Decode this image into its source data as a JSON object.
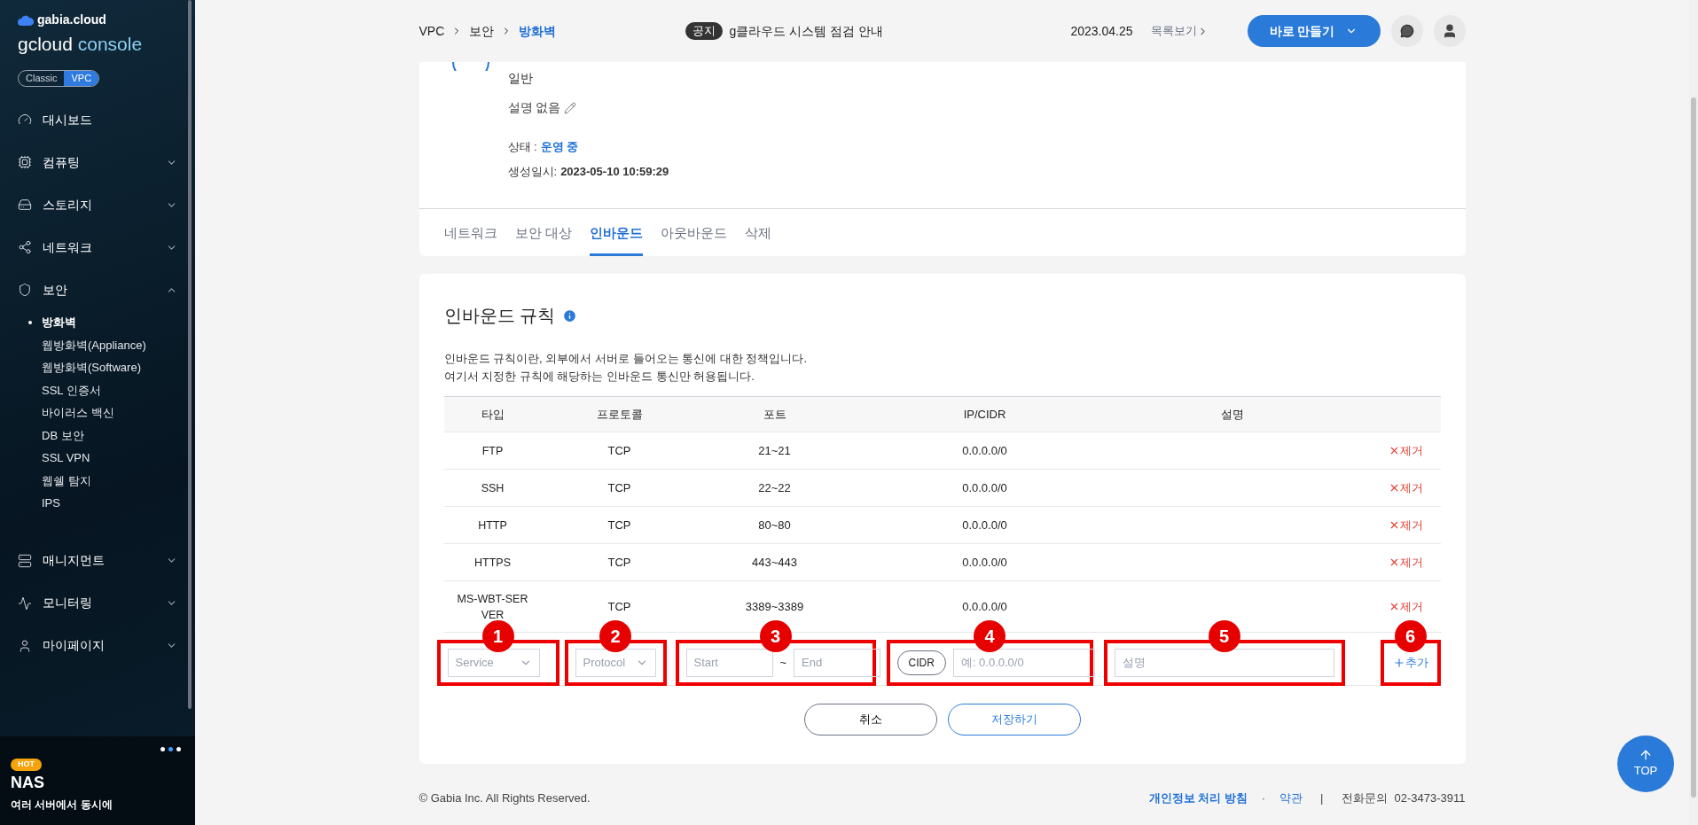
{
  "sidebar": {
    "brand": "gabia.cloud",
    "product_name": "gcloud",
    "product_suffix": "console",
    "mode_toggle": [
      {
        "label": "Classic",
        "selected": false
      },
      {
        "label": "VPC",
        "selected": true
      }
    ],
    "menu": [
      {
        "label": "대시보드",
        "kind": "link"
      },
      {
        "label": "컴퓨팅",
        "kind": "group",
        "expanded": false
      },
      {
        "label": "스토리지",
        "kind": "group",
        "expanded": false
      },
      {
        "label": "네트워크",
        "kind": "group",
        "expanded": false
      },
      {
        "label": "보안",
        "kind": "group",
        "expanded": true,
        "children": [
          {
            "label": "방화벽",
            "selected": true
          },
          {
            "label": "웹방화벽(Appliance)",
            "selected": false
          },
          {
            "label": "웹방화벽(Software)",
            "selected": false
          },
          {
            "label": "SSL 인증서",
            "selected": false
          },
          {
            "label": "바이러스 백신",
            "selected": false
          },
          {
            "label": "DB 보안",
            "selected": false
          },
          {
            "label": "SSL VPN",
            "selected": false
          },
          {
            "label": "웹쉘 탐지",
            "selected": false
          },
          {
            "label": "IPS",
            "selected": false
          }
        ]
      },
      {
        "label": "매니지먼트",
        "kind": "group",
        "expanded": false
      },
      {
        "label": "모니터링",
        "kind": "group",
        "expanded": false
      },
      {
        "label": "마이페이지",
        "kind": "group",
        "expanded": false
      }
    ],
    "banner": {
      "badge": "HOT",
      "title": "NAS",
      "text": "여러 서버에서 동시에",
      "dots": [
        {
          "selected": false
        },
        {
          "selected": true
        },
        {
          "selected": false
        }
      ]
    }
  },
  "header": {
    "breadcrumb": [
      {
        "label": "VPC",
        "selected": false
      },
      {
        "label": "보안",
        "selected": false
      },
      {
        "label": "방화벽",
        "selected": true
      }
    ],
    "notice": {
      "badge": "공지",
      "text": "g클라우드 시스템 점검 안내",
      "date": "2023.04.25",
      "list_link": "목록보기"
    },
    "create_button": "바로 만들기"
  },
  "detail": {
    "type": "일반",
    "description": "설명 없음",
    "status_label": "상태 :",
    "status": "운영 중",
    "created_label": "생성일시:",
    "created": "2023-05-10 10:59:29"
  },
  "tabs": [
    {
      "label": "네트워크",
      "selected": false
    },
    {
      "label": "보안 대상",
      "selected": false
    },
    {
      "label": "인바운드",
      "selected": true
    },
    {
      "label": "아웃바운드",
      "selected": false
    },
    {
      "label": "삭제",
      "selected": false
    }
  ],
  "rules": {
    "title": "인바운드 규칙",
    "description": [
      "인바운드 규칙이란, 외부에서 서버로 들어오는 통신에 대한 정책입니다.",
      "여기서 지정한 규칙에 해당하는 인바운드 통신만 허용됩니다."
    ],
    "columns": [
      "타입",
      "프로토콜",
      "포트",
      "IP/CIDR",
      "설명"
    ],
    "rows": [
      {
        "type": "FTP",
        "protocol": "TCP",
        "port": "21~21",
        "ip": "0.0.0.0/0",
        "action": "제거"
      },
      {
        "type": "SSH",
        "protocol": "TCP",
        "port": "22~22",
        "ip": "0.0.0.0/0",
        "action": "제거"
      },
      {
        "type": "HTTP",
        "protocol": "TCP",
        "port": "80~80",
        "ip": "0.0.0.0/0",
        "action": "제거"
      },
      {
        "type": "HTTPS",
        "protocol": "TCP",
        "port": "443~443",
        "ip": "0.0.0.0/0",
        "action": "제거"
      },
      {
        "type": "MS-WBT-SERVER",
        "protocol": "TCP",
        "port": "3389~3389",
        "ip": "0.0.0.0/0",
        "action": "제거"
      }
    ],
    "new_rule": {
      "service": "Service",
      "protocol": "Protocol",
      "port_start_placeholder": "Start",
      "port_separator": "~",
      "port_end_placeholder": "End",
      "cidr_button": "CIDR",
      "ip_placeholder": "예: 0.0.0.0/0",
      "description_placeholder": "설명",
      "add": "추가"
    },
    "callouts": [
      "1",
      "2",
      "3",
      "4",
      "5",
      "6"
    ],
    "cancel": "취소",
    "save": "저장하기"
  },
  "footer": {
    "copyright": "© Gabia Inc. All Rights Reserved.",
    "privacy": "개인정보 처리 방침",
    "dot": "·",
    "terms": "약관",
    "separator": "|",
    "phone_label": "전화문의",
    "phone": "02-3473-3911"
  },
  "top_button": "TOP"
}
